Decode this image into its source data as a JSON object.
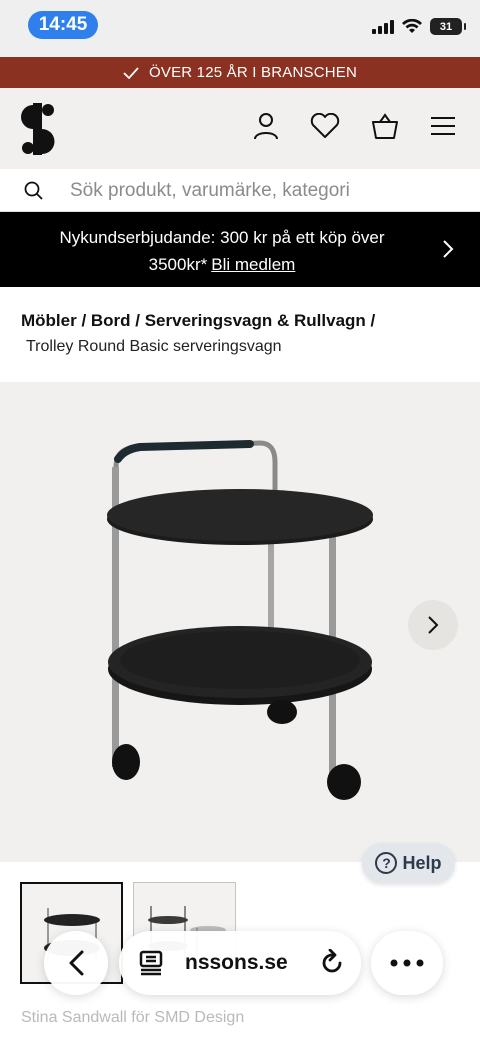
{
  "status_bar": {
    "time": "14:45",
    "battery": "31"
  },
  "promo": {
    "text": "ÖVER 125 ÅR I BRANSCHEN"
  },
  "header": {
    "logo_icon": "svenssons-s-logo",
    "icons": [
      "user-icon",
      "heart-icon",
      "basket-icon",
      "menu-icon"
    ]
  },
  "search": {
    "placeholder": "Sök produkt, varumärke, kategori"
  },
  "banner": {
    "text": "Nykundserbjudande: 300 kr på ett köp över 3500kr*",
    "link": "Bli medlem"
  },
  "breadcrumb": {
    "path": "Möbler / Bord / Serveringsvagn & Rullvagn /",
    "current": "Trolley Round Basic serveringsvagn"
  },
  "help": {
    "label": "Help"
  },
  "designer": {
    "text": "Stina Sandwall för SMD Design"
  },
  "browser": {
    "url": "nssons.se"
  },
  "colors": {
    "promo_bg": "#8a3121",
    "header_bg": "#f1f0ee",
    "banner_bg": "#000000",
    "time_pill": "#2f80ed"
  }
}
